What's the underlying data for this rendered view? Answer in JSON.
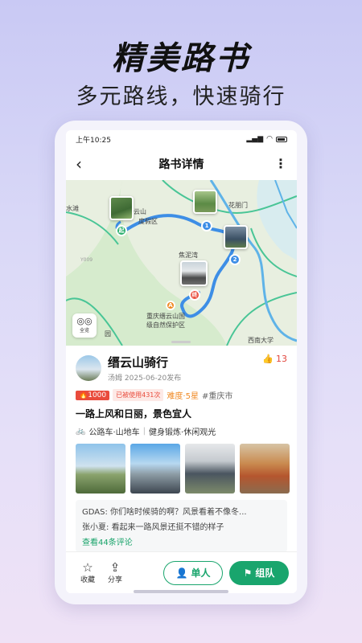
{
  "promo": {
    "title": "精美路书",
    "subtitle": "多元路线，快速骑行"
  },
  "status_bar": {
    "time": "上午10:25",
    "signal": "4G"
  },
  "nav": {
    "title": "路书详情",
    "back_icon": "chevron-left-icon",
    "more_icon": "more-vertical-icon"
  },
  "map": {
    "labels": {
      "huaming": "花朋门",
      "shuitan": "水滩",
      "yunshan": "云山",
      "resort": "度假区",
      "jiaonidun": "焦泥湾",
      "route_code": "Y009",
      "park_line1": "重庆缙云山国",
      "park_line2": "级自然保护区",
      "university": "西南大学",
      "park_short": "园"
    },
    "markers": {
      "start": "起",
      "end": "终",
      "wp1": "1",
      "wp2": "2"
    },
    "fullscreen_label": "全览",
    "colors": {
      "route": "#3d8ee6",
      "river": "#5fb3e8",
      "road": "#49c596",
      "land": "#e8efe0",
      "park": "#cfe8c8"
    }
  },
  "route": {
    "name": "缙云山骑行",
    "author": "汤姆",
    "date": "2025-06-20发布",
    "likes": "13",
    "hot_value": "1000",
    "used_text": "已被使用431次",
    "difficulty": "难度·5星",
    "city": "#重庆市",
    "description": "一路上风和日丽，景色宜人",
    "bike_types": "公路车·山地车",
    "purposes": "健身锻炼·休闲观光",
    "photo_count": 4
  },
  "comments": {
    "items": [
      {
        "user": "GDAS:",
        "text": "你们啥时候骑的啊？风景看着不像冬..."
      },
      {
        "user": "张小夏:",
        "text": "看起来一路风景还挺不错的样子"
      }
    ],
    "see_all": "查看44条评论"
  },
  "bottom_bar": {
    "collect_label": "收藏",
    "share_label": "分享",
    "single_label": "单人",
    "team_label": "组队"
  },
  "colors": {
    "accent_green": "#19a56d",
    "like_red": "#e2463d",
    "hot_red": "#e94b3c",
    "difficulty_orange": "#f08a24"
  }
}
